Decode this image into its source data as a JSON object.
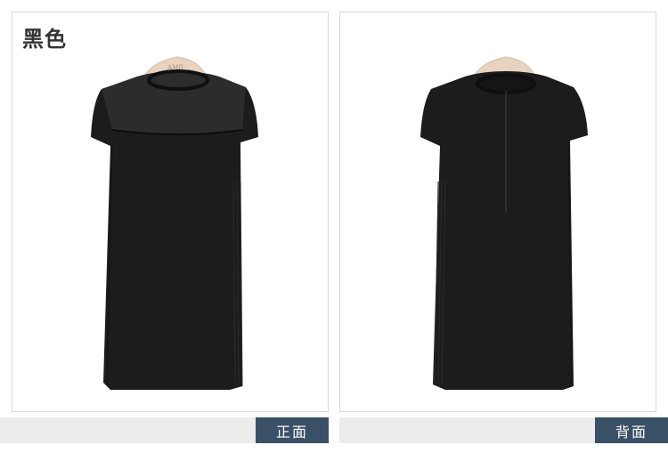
{
  "color_name": "黑色",
  "hanger_brand": "AMII",
  "panels": [
    {
      "view_label": "正面",
      "view": "front"
    },
    {
      "view_label": "背面",
      "view": "back"
    }
  ],
  "colors": {
    "dress": "#1c1c1c",
    "label_bg": "#3a5066",
    "footer_bg": "#ececec",
    "hanger": "#e9d2bf"
  }
}
